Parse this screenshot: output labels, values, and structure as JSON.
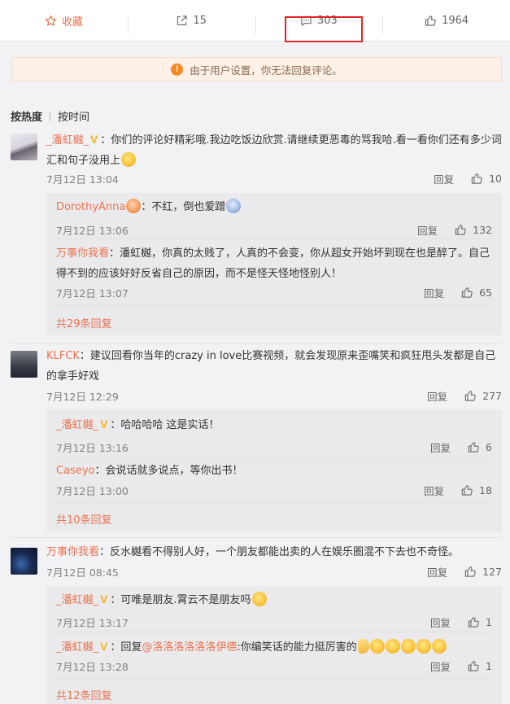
{
  "actions": {
    "favorite_label": "收藏",
    "share_count": "15",
    "comment_count": "303",
    "like_count": "1964"
  },
  "notice": "由于用户设置，你无法回复评论。",
  "sort": {
    "hot": "按热度",
    "time": "按时间"
  },
  "comments": [
    {
      "user": "_潘虹樾_",
      "text": "：你们的评论好精彩哦.我边吃饭边欣赏.请继续更恶毒的骂我哈.看一看你们还有多少词汇和句子没用上",
      "time": "7月12日 13:04",
      "reply": "回复",
      "likes": "10",
      "replies": [
        {
          "user": "DorothyAnna",
          "text": "：不红，倒也爱蹭",
          "time": "7月12日 13:06",
          "reply": "回复",
          "likes": "132"
        },
        {
          "user": "万事你我看",
          "text": "：潘虹樾，你真的太贱了，人真的不会变，你从超女开始坏到现在也是醉了。自己得不到的应该好好反省自己的原因，而不是怪天怪地怪别人！",
          "time": "7月12日 13:07",
          "reply": "回复",
          "likes": "65"
        }
      ],
      "more": "共29条回复"
    },
    {
      "user": "KLFCK",
      "text": "：建议回看你当年的crazy in love比赛视频，就会发现原来歪嘴笑和疯狂甩头发都是自己的拿手好戏",
      "time": "7月12日 12:29",
      "reply": "回复",
      "likes": "277",
      "replies": [
        {
          "user": "_潘虹樾_",
          "text": "：哈哈哈哈 这是实话！",
          "time": "7月12日 13:16",
          "reply": "回复",
          "likes": "6"
        },
        {
          "user": "Caseyo",
          "text": "：会说话就多说点，等你出书！",
          "time": "7月12日 13:00",
          "reply": "回复",
          "likes": "18"
        }
      ],
      "more": "共10条回复"
    },
    {
      "user": "万事你我看",
      "text": "：反水樾看不得别人好，一个朋友都能出卖的人在娱乐圈混不下去也不奇怪。",
      "time": "7月12日 08:45",
      "reply": "回复",
      "likes": "127",
      "replies": [
        {
          "user": "_潘虹樾_",
          "text": "：可唯是朋友.霄云不是朋友吗",
          "time": "7月12日 13:17",
          "reply": "回复",
          "likes": "1"
        },
        {
          "user": "_潘虹樾_",
          "text_prefix": "：回复",
          "at_user": "@洛洛洛洛洛洛伊德",
          "text": ":你编笑话的能力挺厉害的",
          "time": "7月12日 13:28",
          "reply": "回复",
          "likes": "1"
        }
      ],
      "more": "共12条回复"
    }
  ],
  "colors": {
    "accent": "#eb7350",
    "vip": "#f6b11c",
    "highlight": "#e02525"
  }
}
